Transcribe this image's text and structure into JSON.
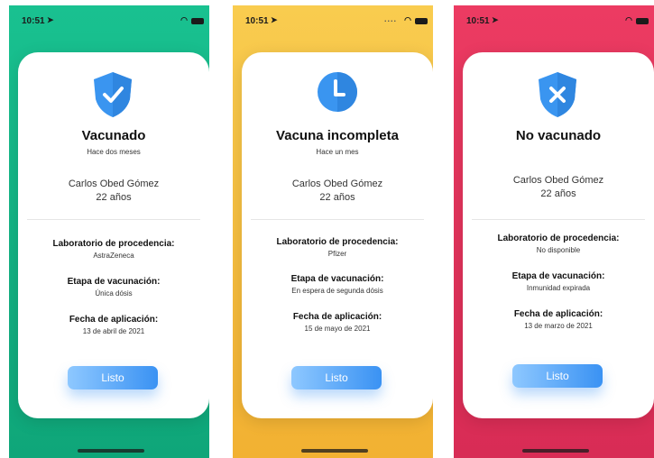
{
  "screens": [
    {
      "status": {
        "time": "10:51"
      },
      "background": "#1ec38f",
      "icon": "check-shield-icon",
      "title": "Vacunado",
      "subtitle": "Hace dos meses",
      "name": "Carlos Obed Gómez",
      "age": "22 años",
      "lab_label": "Laboratorio de procedencia:",
      "lab_value": "AstraZeneca",
      "stage_label": "Etapa de vacunación:",
      "stage_value": "Única dósis",
      "date_label": "Fecha de aplicación:",
      "date_value": "13 de abril de 2021",
      "button": "Listo"
    },
    {
      "status": {
        "time": "10:51"
      },
      "background": "#f7c245",
      "icon": "clock-icon",
      "title": "Vacuna incompleta",
      "subtitle": "Hace un mes",
      "name": "Carlos Obed Gómez",
      "age": "22 años",
      "lab_label": "Laboratorio de procedencia:",
      "lab_value": "Pfizer",
      "stage_label": "Etapa de vacunación:",
      "stage_value": "En espera de segunda dósis",
      "date_label": "Fecha de aplicación:",
      "date_value": "15 de mayo de 2021",
      "button": "Listo"
    },
    {
      "status": {
        "time": "10:51"
      },
      "background": "#e8345e",
      "icon": "x-shield-icon",
      "title": "No vacunado",
      "subtitle": "",
      "name": "Carlos Obed Gómez",
      "age": "22 años",
      "lab_label": "Laboratorio de procedencia:",
      "lab_value": "No disponible",
      "stage_label": "Etapa de vacunación:",
      "stage_value": "Inmunidad expirada",
      "date_label": "Fecha de aplicación:",
      "date_value": "13 de marzo de 2021",
      "button": "Listo"
    }
  ],
  "colors": {
    "icon_blue": "#3a95f0",
    "button_start": "#8ec8ff",
    "button_end": "#3a92f3"
  }
}
